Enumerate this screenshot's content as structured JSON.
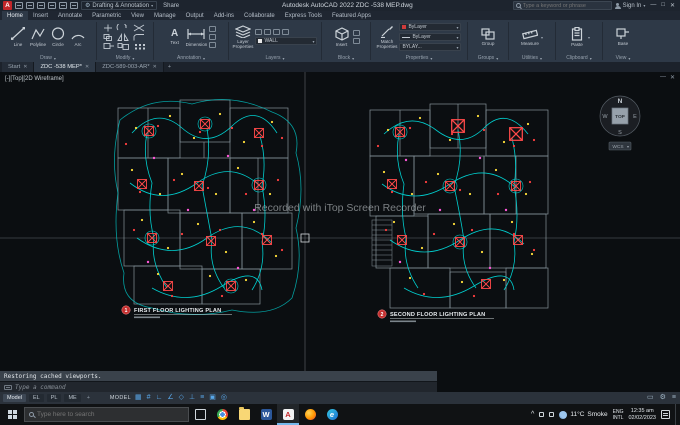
{
  "icons": {
    "close": "✕",
    "minimize": "—",
    "maximize": "□",
    "chevron_down": "▾",
    "chevron_up": "^",
    "gear": "⚙"
  },
  "titlebar": {
    "logo_letter": "A",
    "qat": [
      {
        "name": "new-file-icon"
      },
      {
        "name": "open-file-icon"
      },
      {
        "name": "save-icon"
      },
      {
        "name": "print-icon"
      },
      {
        "name": "undo-icon"
      },
      {
        "name": "redo-icon"
      }
    ],
    "workspace": "Drafting & Annotation",
    "share": "Share",
    "title": "Autodesk AutoCAD 2022    ZDC -538 MEP.dwg",
    "search_placeholder": "Type a keyword or phrase",
    "sign_in": "Sign In"
  },
  "ribbon_tabs": [
    {
      "label": "Home",
      "active": true
    },
    {
      "label": "Insert"
    },
    {
      "label": "Annotate"
    },
    {
      "label": "Parametric"
    },
    {
      "label": "View"
    },
    {
      "label": "Manage"
    },
    {
      "label": "Output"
    },
    {
      "label": "Add-ins"
    },
    {
      "label": "Collaborate"
    },
    {
      "label": "Express Tools"
    },
    {
      "label": "Featured Apps"
    }
  ],
  "ribbon": {
    "draw": {
      "title": "Draw",
      "tools": [
        "Line",
        "Polyline",
        "Circle",
        "Arc"
      ]
    },
    "modify": {
      "title": "Modify"
    },
    "annotation": {
      "title": "Annotation",
      "text_icon": "A",
      "text": "Text",
      "dimension": "Dimension"
    },
    "layers": {
      "title": "Layers",
      "label1": "Layer",
      "label2": "Properties",
      "current_layer": "WALL"
    },
    "block": {
      "title": "Block",
      "insert": "Insert"
    },
    "properties": {
      "title": "Properties",
      "match1": "Match",
      "match2": "Properties",
      "color": "ByLayer",
      "linetype": "ByLayer",
      "lineweight": "BYLAY..."
    },
    "groups": {
      "title": "Groups",
      "group": "Group"
    },
    "utilities": {
      "title": "Utilities",
      "measure": "Measure"
    },
    "clipboard": {
      "title": "Clipboard",
      "paste": "Paste"
    },
    "view": {
      "title": "View",
      "base": "Base"
    }
  },
  "file_tabs": [
    {
      "label": "Start"
    },
    {
      "label": "ZDC -538 MEP*",
      "active": true
    },
    {
      "label": "ZDC-589-003-AR*"
    }
  ],
  "drawing": {
    "viewport_label": "[-][Top][2D Wireframe]",
    "watermark": "Recorded with iTop Screen Recorder",
    "viewcube": {
      "n": "N",
      "e": "E",
      "s": "S",
      "w": "W",
      "top": "TOP",
      "wcs": "WCS"
    },
    "plans": [
      {
        "num": "1",
        "title": "FIRST FLOOR LIGHTING PLAN"
      },
      {
        "num": "2",
        "title": "SECOND FLOOR LIGHTING PLAN"
      }
    ]
  },
  "command_line": {
    "history": "Restoring cached viewports.",
    "hint": "Type a command"
  },
  "status_bar": {
    "layout_tabs": [
      {
        "label": "Model",
        "active": true
      },
      {
        "label": "EL"
      },
      {
        "label": "PL"
      },
      {
        "label": "ME"
      }
    ],
    "add_tab": "+",
    "model": "MODEL",
    "icons": [
      {
        "name": "grid-icon",
        "glyph": "▦"
      },
      {
        "name": "snap-icon",
        "glyph": "#"
      },
      {
        "name": "ortho-icon",
        "glyph": "∟"
      },
      {
        "name": "polar-tracking-icon",
        "glyph": "∠"
      },
      {
        "name": "isodraft-icon",
        "glyph": "◇"
      },
      {
        "name": "object-snap-icon",
        "glyph": "⊥"
      },
      {
        "name": "lineweight-icon",
        "glyph": "≡"
      },
      {
        "name": "selection-cycling-icon",
        "glyph": "▣"
      },
      {
        "name": "dynamic-ucs-icon",
        "glyph": "◎"
      }
    ]
  },
  "taskbar": {
    "search_placeholder": "Type here to search",
    "apps": [
      {
        "name": "task-view-icon",
        "glyph": ""
      },
      {
        "name": "chrome-icon",
        "glyph": ""
      },
      {
        "name": "file-explorer-icon",
        "glyph": ""
      },
      {
        "name": "word-icon",
        "glyph": "W"
      },
      {
        "name": "autocad-icon",
        "glyph": "A",
        "active": true
      },
      {
        "name": "firefox-icon",
        "glyph": ""
      },
      {
        "name": "edge-icon",
        "glyph": "e"
      }
    ],
    "tray": {
      "temp": "11°C",
      "condition": "Smoke",
      "lang": "ENG",
      "lang_sub": "INTL",
      "time": "12:35 am",
      "date": "02/02/2023"
    }
  }
}
